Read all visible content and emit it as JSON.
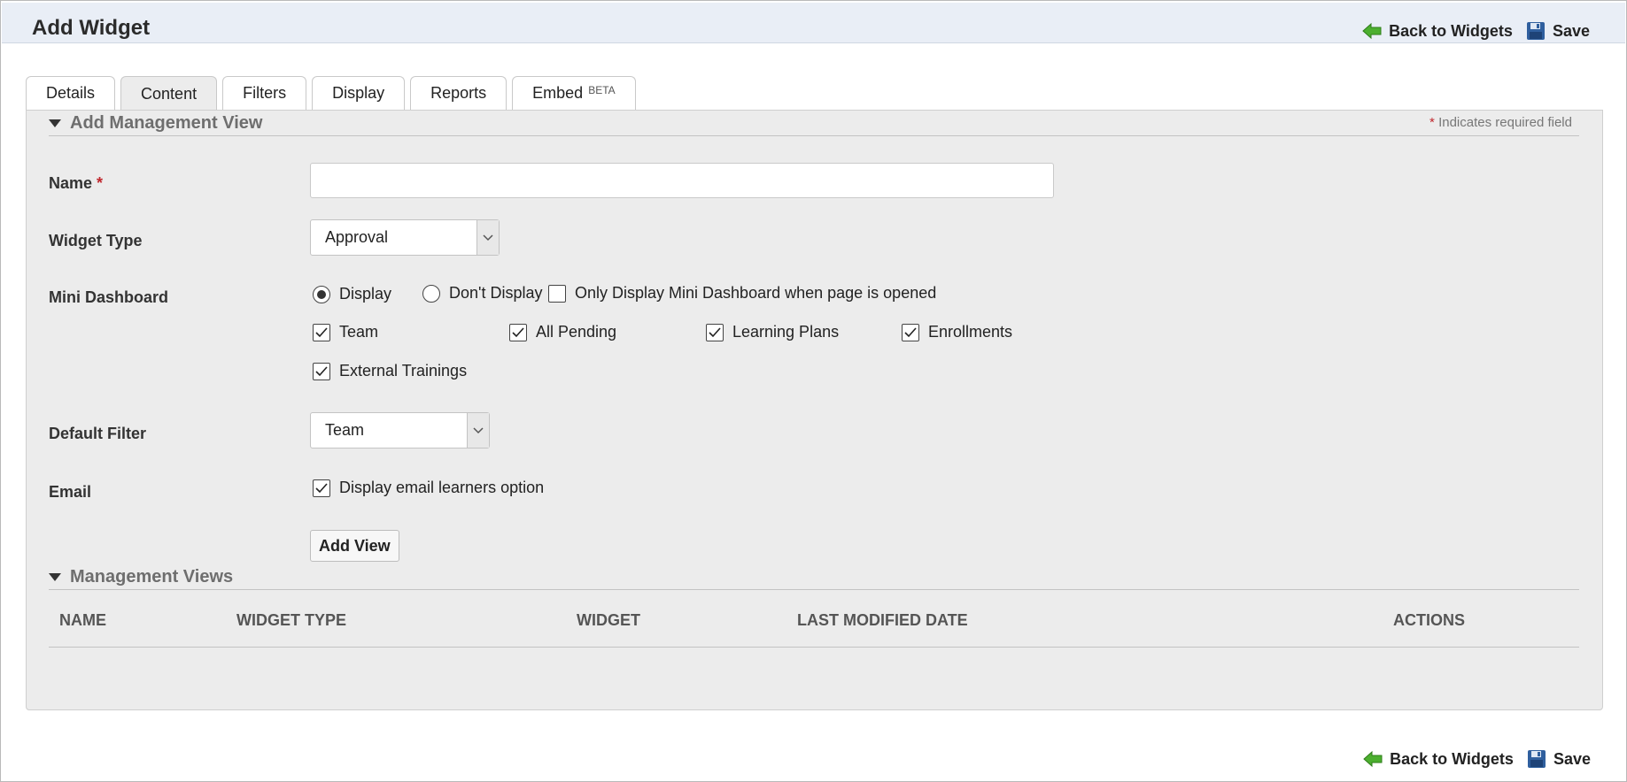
{
  "header": {
    "title": "Add Widget",
    "back_label": "Back to Widgets",
    "save_label": "Save"
  },
  "tabs": [
    {
      "label": "Details",
      "active": false
    },
    {
      "label": "Content",
      "active": true
    },
    {
      "label": "Filters",
      "active": false
    },
    {
      "label": "Display",
      "active": false
    },
    {
      "label": "Reports",
      "active": false
    },
    {
      "label": "Embed",
      "badge": "BETA",
      "active": false
    }
  ],
  "add_view": {
    "title": "Add Management View",
    "required_star": "*",
    "required_note": "Indicates required field",
    "name_label": "Name",
    "name_value": "",
    "widget_type_label": "Widget Type",
    "widget_type_value": "Approval",
    "mini_dashboard_label": "Mini Dashboard",
    "mini_dashboard_options": {
      "display": "Display",
      "dont_display": "Don't Display",
      "only_when_opened": "Only Display Mini Dashboard when page is opened",
      "selected": "display",
      "only_when_opened_checked": false
    },
    "dashboard_items": [
      {
        "label": "Team",
        "checked": true
      },
      {
        "label": "All Pending",
        "checked": true
      },
      {
        "label": "Learning Plans",
        "checked": true
      },
      {
        "label": "Enrollments",
        "checked": true
      },
      {
        "label": "External Trainings",
        "checked": true
      }
    ],
    "default_filter_label": "Default Filter",
    "default_filter_value": "Team",
    "email_label": "Email",
    "email_option": "Display email learners option",
    "email_checked": true,
    "add_button_label": "Add View"
  },
  "management_views": {
    "title": "Management Views",
    "columns": [
      "NAME",
      "WIDGET TYPE",
      "WIDGET",
      "LAST MODIFIED DATE",
      "ACTIONS"
    ],
    "rows": []
  },
  "colors": {
    "header_bg": "#e9eef6",
    "panel_bg": "#ececec",
    "required_star": "#c0272d",
    "back_arrow": "#4caf2f",
    "save_icon": "#2f5f9e"
  },
  "icons": {
    "back": "green-left-arrow-icon",
    "save": "floppy-disk-icon",
    "dropdown": "chevron-down-icon",
    "section_toggle": "caret-down-icon"
  }
}
